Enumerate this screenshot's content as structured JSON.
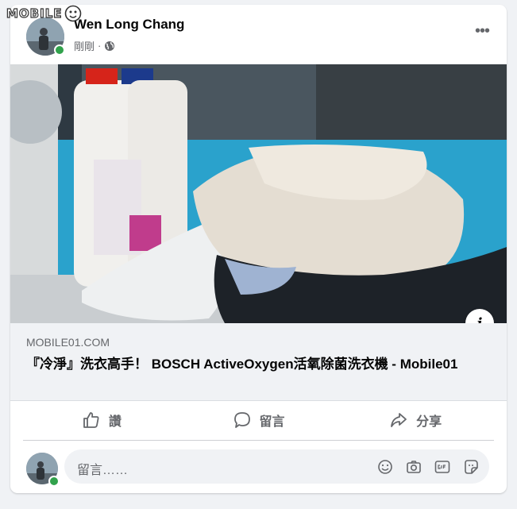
{
  "watermark": {
    "text": "MOBILE"
  },
  "post": {
    "author": "Wen Long Chang",
    "time": "剛剛",
    "separator": "·",
    "privacy_icon": "globe-icon",
    "more_icon": "more-options-icon"
  },
  "link": {
    "domain": "MOBILE01.COM",
    "title": "『冷淨』洗衣高手！ BOSCH ActiveOxygen活氧除菌洗衣機 - Mobile01",
    "info_icon": "i"
  },
  "actions": {
    "like": "讚",
    "comment": "留言",
    "share": "分享"
  },
  "comment_box": {
    "placeholder": "留言……",
    "icons": [
      "emoji-icon",
      "camera-icon",
      "gif-icon",
      "sticker-icon"
    ]
  },
  "colors": {
    "accent_online": "#31a24c",
    "text_primary": "#050505",
    "text_secondary": "#65676b",
    "background": "#f0f2f5"
  }
}
